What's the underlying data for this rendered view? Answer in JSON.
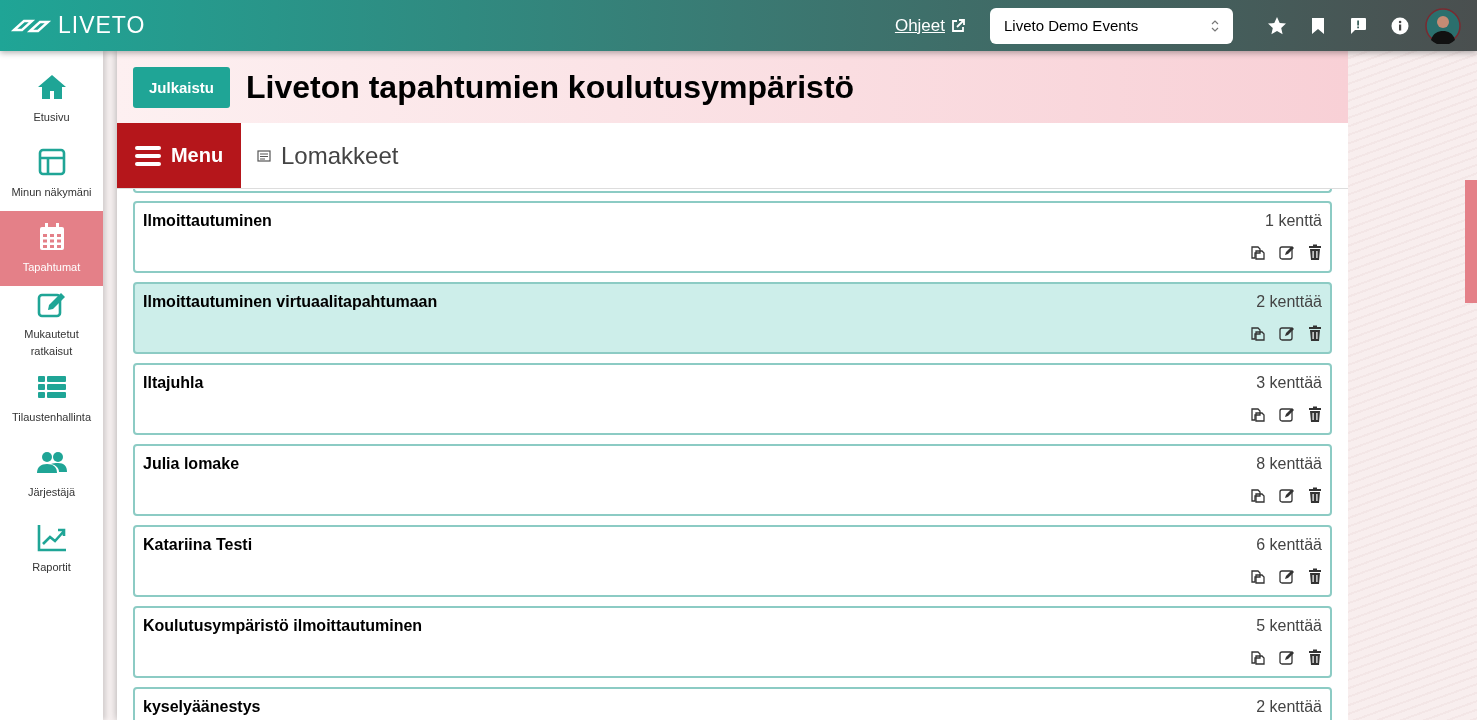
{
  "header": {
    "logo": "LIVETO",
    "help_link": "Ohjeet",
    "organizer_select": {
      "value": "Liveto Demo Events"
    }
  },
  "sidebar": {
    "items": [
      {
        "label": "Etusivu",
        "selected": false
      },
      {
        "label": "Minun näkymäni",
        "selected": false
      },
      {
        "label": "Tapahtumat",
        "selected": true
      },
      {
        "label": "Mukautetut ratkaisut",
        "selected": false
      },
      {
        "label": "Tilaustenhallinta",
        "selected": false
      },
      {
        "label": "Järjestäjä",
        "selected": false
      },
      {
        "label": "Raportit",
        "selected": false
      }
    ]
  },
  "event": {
    "status": "Julkaistu",
    "title": "Liveton tapahtumien koulutusympäristö"
  },
  "menu_button": "Menu",
  "section": "Lomakkeet",
  "forms": [
    {
      "name": "Ilmoittautuminen",
      "fields": "1 kenttä",
      "selected": false
    },
    {
      "name": "Ilmoittautuminen virtuaalitapahtumaan",
      "fields": "2 kenttää",
      "selected": true
    },
    {
      "name": "Iltajuhla",
      "fields": "3 kenttää",
      "selected": false
    },
    {
      "name": "Julia lomake",
      "fields": "8 kenttää",
      "selected": false
    },
    {
      "name": "Katariina Testi",
      "fields": "6 kenttää",
      "selected": false
    },
    {
      "name": "Koulutusympäristö ilmoittautuminen",
      "fields": "5 kenttää",
      "selected": false
    },
    {
      "name": "kyselyäänestys",
      "fields": "2 kenttää",
      "selected": false
    }
  ]
}
